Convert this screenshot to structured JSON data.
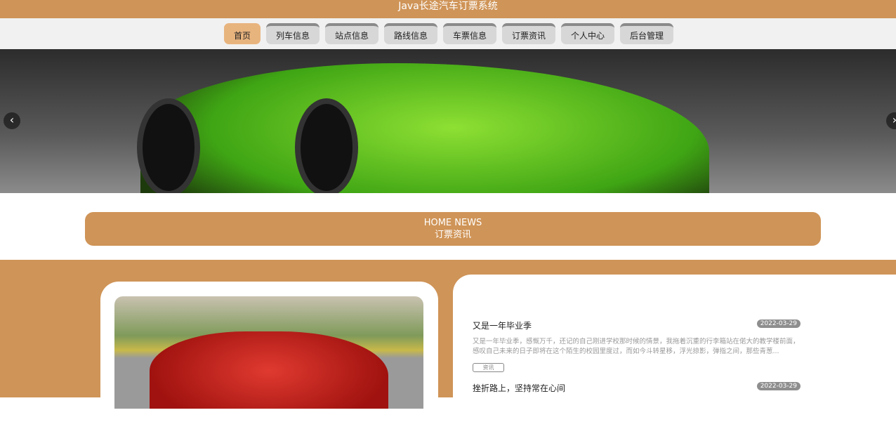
{
  "header": {
    "title": "Java长途汽车订票系统"
  },
  "nav": [
    {
      "label": "首页",
      "active": true
    },
    {
      "label": "列车信息"
    },
    {
      "label": "站点信息"
    },
    {
      "label": "路线信息"
    },
    {
      "label": "车票信息"
    },
    {
      "label": "订票资讯"
    },
    {
      "label": "个人中心"
    },
    {
      "label": "后台管理"
    }
  ],
  "carousel": {
    "prev": "‹",
    "next": "›"
  },
  "section": {
    "title_en": "HOME NEWS",
    "title_cn": "订票资讯"
  },
  "news": [
    {
      "title": "又是一年毕业季",
      "date": "2022-03-29",
      "summary": "又是一年毕业季，感慨万千，还记的自己刚进学校那时候的情景，我拖着沉重的行李箱站在偌大的教学楼前面，感叹自己未来的日子即将在这个陌生的校园里度过，而如今斗转星移，浮光掠影，弹指之间，那些青葱...",
      "tag": "资讯"
    },
    {
      "title": "挫折路上，坚持常在心间",
      "date": "2022-03-29"
    }
  ],
  "colors": {
    "accent": "#cf9457",
    "nav_active": "#e8b47e"
  }
}
